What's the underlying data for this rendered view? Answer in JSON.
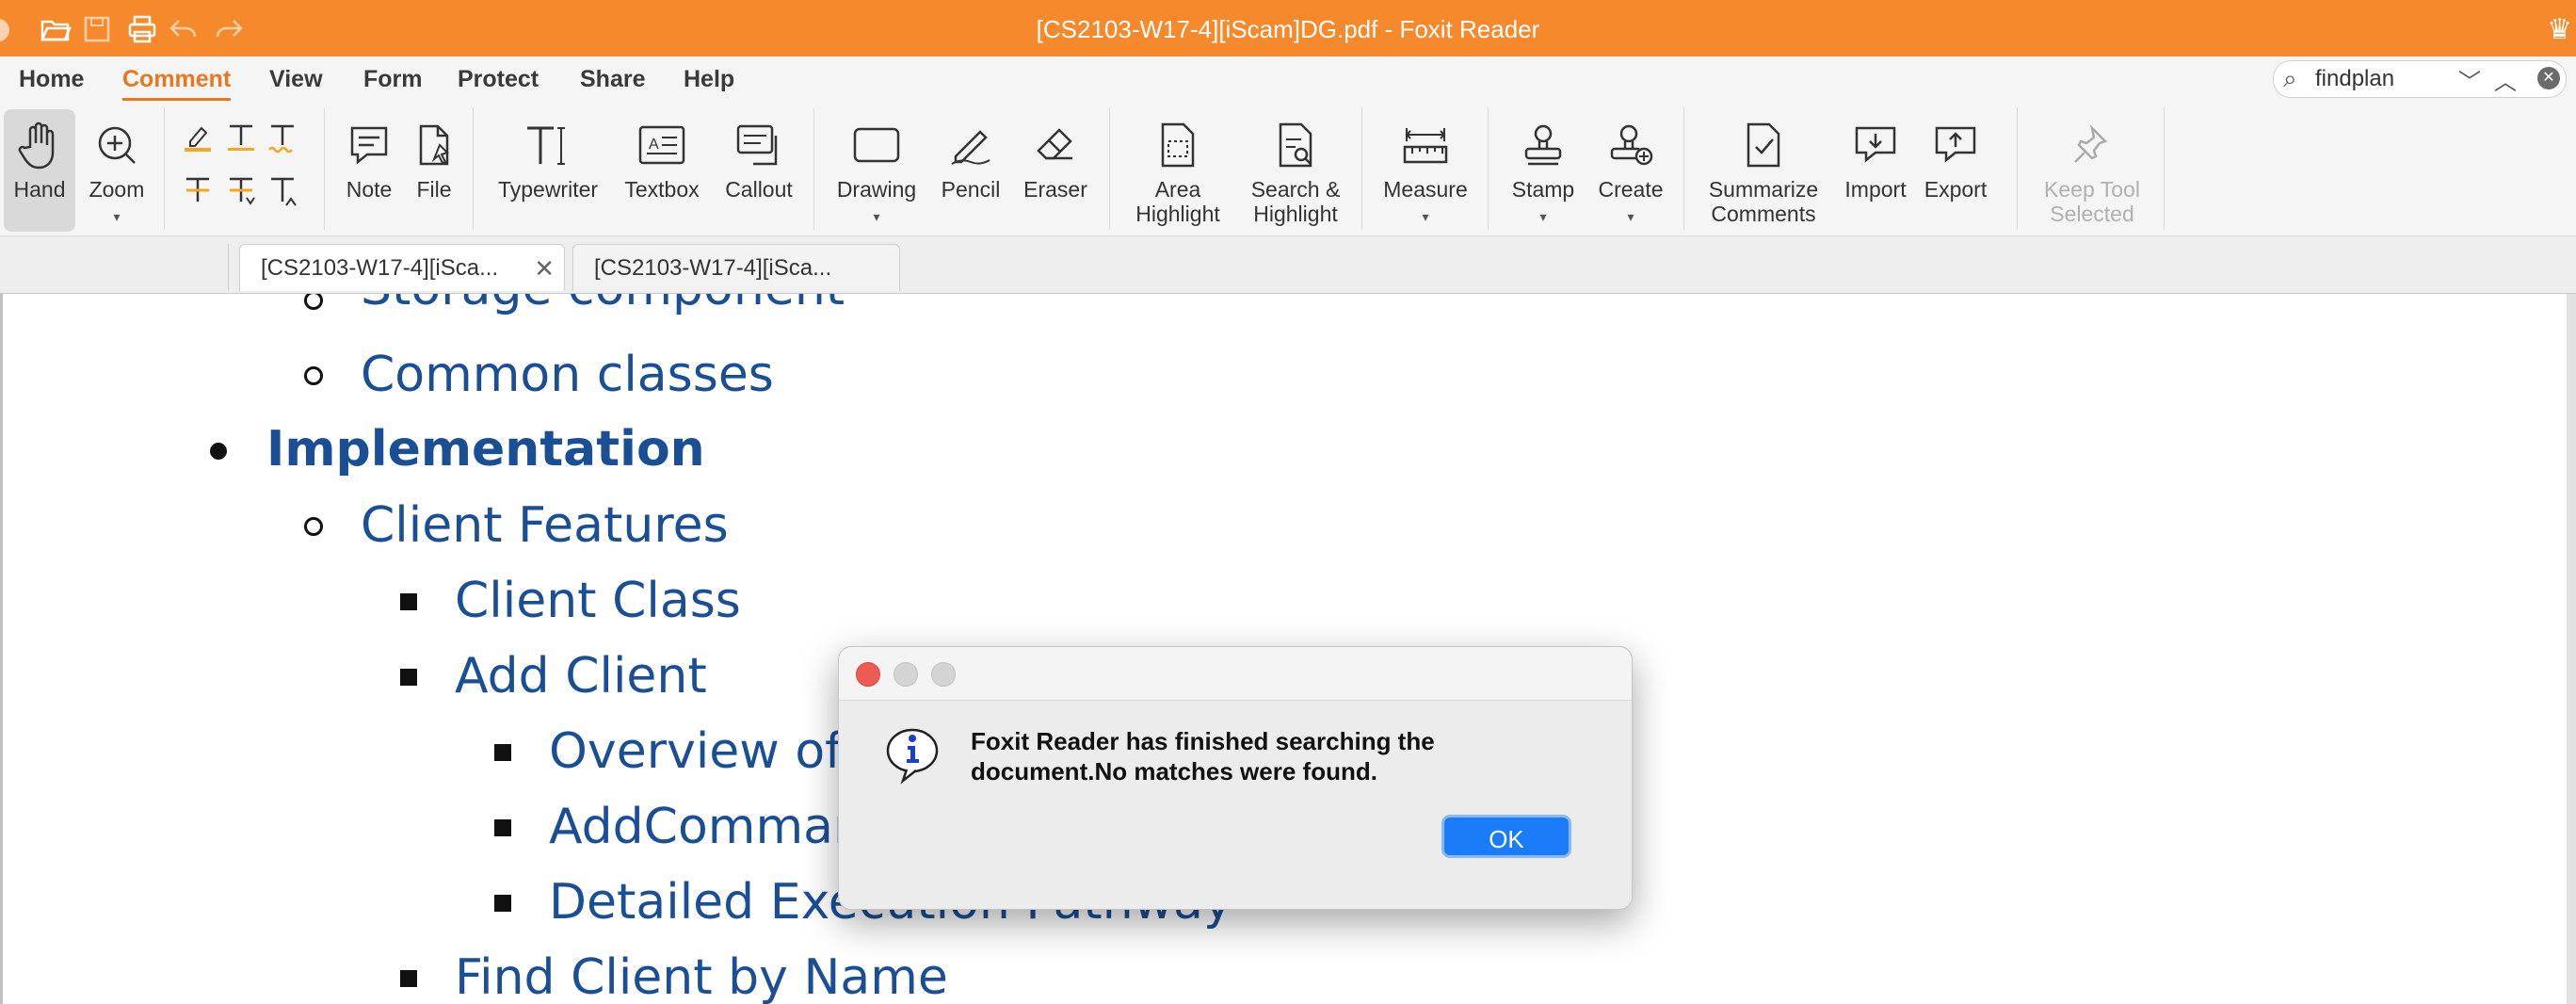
{
  "window": {
    "title": "[CS2103-W17-4][iScam]DG.pdf - Foxit Reader",
    "accent": "#f5892b"
  },
  "menu": [
    "Home",
    "Comment",
    "View",
    "Form",
    "Protect",
    "Share",
    "Help"
  ],
  "menu_active": "Comment",
  "search": {
    "value": "findplan"
  },
  "ribbon": {
    "hand": "Hand",
    "zoom": "Zoom",
    "note": "Note",
    "file": "File",
    "typewriter": "Typewriter",
    "textbox": "Textbox",
    "callout": "Callout",
    "drawing": "Drawing",
    "pencil": "Pencil",
    "eraser": "Eraser",
    "area_highlight": [
      "Area",
      "Highlight"
    ],
    "search_highlight": [
      "Search &",
      "Highlight"
    ],
    "measure": "Measure",
    "stamp": "Stamp",
    "create": "Create",
    "summarize": [
      "Summarize",
      "Comments"
    ],
    "import": "Import",
    "export": "Export",
    "keep_tool": [
      "Keep Tool",
      "Selected"
    ]
  },
  "tabs": [
    "[CS2103-W17-4][iSca...",
    "[CS2103-W17-4][iSca..."
  ],
  "document": {
    "lines": [
      "Storage component",
      "Common classes",
      "Implementation",
      "Client Features",
      "Client Class",
      "Add Client",
      "Overview of A",
      "AddComman",
      "Detailed Execution Pathway",
      "Find Client by Name"
    ]
  },
  "dialog": {
    "message_line1": "Foxit Reader has finished searching the",
    "message_line2": "document.No matches were found.",
    "ok": "OK"
  }
}
